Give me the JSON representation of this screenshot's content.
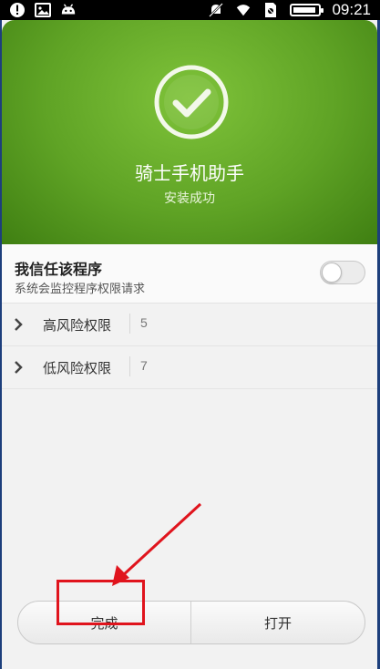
{
  "status_bar": {
    "time": "09:21",
    "battery_level": 0.9
  },
  "header": {
    "app_name": "骑士手机助手",
    "install_status": "安装成功"
  },
  "trust": {
    "title": "我信任该程序",
    "subtitle": "系统会监控程序权限请求",
    "toggle_on": false
  },
  "permissions": [
    {
      "label": "高风险权限",
      "count": "5"
    },
    {
      "label": "低风险权限",
      "count": "7"
    }
  ],
  "buttons": {
    "done_label": "完成",
    "open_label": "打开"
  },
  "colors": {
    "header_green": "#5fa325",
    "annotation_red": "#e0141d"
  }
}
